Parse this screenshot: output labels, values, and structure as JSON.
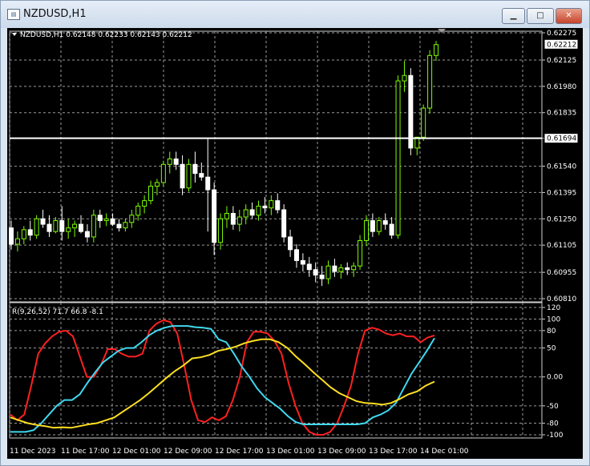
{
  "window": {
    "title": "NZDUSD,H1",
    "minimize_icon": "minimize-icon",
    "maximize_icon": "maximize-icon",
    "close_icon": "close-icon"
  },
  "colors": {
    "background": "#000000",
    "grid": "#9a9a9a",
    "bull_candle": "#7CFC00",
    "bear_candle": "#FFFFFF",
    "horizontal_line": "#FFFFFF",
    "red_line": "#FF2020",
    "cyan_line": "#40D8F0",
    "yellow_line": "#FFE020"
  },
  "chart_data": [
    {
      "type": "candlestick",
      "header": "NZDUSD,H1  0.62148 0.62233 0.62143 0.62212",
      "symbol_icon": "triangle-down-icon",
      "ylim": [
        0.6081,
        0.62275
      ],
      "yticks": [
        "0.62275",
        "0.62125",
        "0.61980",
        "0.61835",
        "0.61694",
        "0.61540",
        "0.61395",
        "0.61250",
        "0.61105",
        "0.60955",
        "0.60810"
      ],
      "price_labels": [
        {
          "value": 0.62212,
          "label": "0.62212"
        },
        {
          "value": 0.61694,
          "label": "0.61694"
        }
      ],
      "horizontal_line": 0.61694,
      "candles": [
        [
          0.612,
          0.6124,
          0.6108,
          0.6111
        ],
        [
          0.6111,
          0.6118,
          0.6107,
          0.6114
        ],
        [
          0.6114,
          0.6121,
          0.6111,
          0.6119
        ],
        [
          0.6119,
          0.6124,
          0.6113,
          0.6116
        ],
        [
          0.6116,
          0.6127,
          0.6114,
          0.6125
        ],
        [
          0.6125,
          0.613,
          0.612,
          0.6122
        ],
        [
          0.6122,
          0.6127,
          0.6115,
          0.6118
        ],
        [
          0.6118,
          0.6126,
          0.6117,
          0.6124
        ],
        [
          0.6124,
          0.6132,
          0.6113,
          0.6118
        ],
        [
          0.6118,
          0.6125,
          0.6114,
          0.612
        ],
        [
          0.612,
          0.6124,
          0.6115,
          0.6122
        ],
        [
          0.6122,
          0.6127,
          0.6117,
          0.6118
        ],
        [
          0.6118,
          0.6122,
          0.6112,
          0.6115
        ],
        [
          0.6115,
          0.613,
          0.6112,
          0.6127
        ],
        [
          0.6127,
          0.613,
          0.612,
          0.6124
        ],
        [
          0.6124,
          0.6128,
          0.6121,
          0.6125
        ],
        [
          0.6125,
          0.6128,
          0.6121,
          0.6122
        ],
        [
          0.6122,
          0.6125,
          0.6118,
          0.612
        ],
        [
          0.612,
          0.6125,
          0.6118,
          0.6123
        ],
        [
          0.6123,
          0.613,
          0.612,
          0.6127
        ],
        [
          0.6127,
          0.6134,
          0.6124,
          0.6132
        ],
        [
          0.6132,
          0.6138,
          0.6128,
          0.6135
        ],
        [
          0.6135,
          0.6146,
          0.6133,
          0.6143
        ],
        [
          0.6143,
          0.6147,
          0.6138,
          0.6145
        ],
        [
          0.6145,
          0.6157,
          0.6143,
          0.6155
        ],
        [
          0.6155,
          0.6162,
          0.615,
          0.6158
        ],
        [
          0.6158,
          0.6162,
          0.6152,
          0.6155
        ],
        [
          0.6155,
          0.616,
          0.6138,
          0.6142
        ],
        [
          0.6142,
          0.6158,
          0.614,
          0.6155
        ],
        [
          0.6155,
          0.6162,
          0.6145,
          0.615
        ],
        [
          0.615,
          0.6156,
          0.6146,
          0.6148
        ],
        [
          0.6148,
          0.6169,
          0.6118,
          0.6141
        ],
        [
          0.6141,
          0.6145,
          0.6105,
          0.6112
        ],
        [
          0.6112,
          0.6128,
          0.6108,
          0.6125
        ],
        [
          0.6125,
          0.6132,
          0.612,
          0.6128
        ],
        [
          0.6128,
          0.6132,
          0.6119,
          0.6122
        ],
        [
          0.6122,
          0.613,
          0.6118,
          0.6126
        ],
        [
          0.6126,
          0.6133,
          0.6122,
          0.613
        ],
        [
          0.613,
          0.6134,
          0.6125,
          0.6127
        ],
        [
          0.6127,
          0.6135,
          0.6124,
          0.6132
        ],
        [
          0.6132,
          0.6137,
          0.6128,
          0.6131
        ],
        [
          0.6131,
          0.6138,
          0.6127,
          0.6135
        ],
        [
          0.6135,
          0.6139,
          0.6128,
          0.613
        ],
        [
          0.613,
          0.6133,
          0.6112,
          0.6115
        ],
        [
          0.6115,
          0.6119,
          0.6104,
          0.6108
        ],
        [
          0.6108,
          0.6111,
          0.6098,
          0.6102
        ],
        [
          0.6102,
          0.6106,
          0.6096,
          0.61
        ],
        [
          0.61,
          0.6104,
          0.6093,
          0.6097
        ],
        [
          0.6097,
          0.6101,
          0.609,
          0.6094
        ],
        [
          0.6094,
          0.6099,
          0.6088,
          0.6092
        ],
        [
          0.6092,
          0.6102,
          0.6089,
          0.6099
        ],
        [
          0.6099,
          0.6103,
          0.6093,
          0.6096
        ],
        [
          0.6096,
          0.61,
          0.6092,
          0.6098
        ],
        [
          0.6098,
          0.6101,
          0.6094,
          0.6097
        ],
        [
          0.6097,
          0.6101,
          0.6093,
          0.6099
        ],
        [
          0.6099,
          0.6116,
          0.6097,
          0.6113
        ],
        [
          0.6113,
          0.6127,
          0.611,
          0.6124
        ],
        [
          0.6124,
          0.6128,
          0.6115,
          0.6118
        ],
        [
          0.6118,
          0.6126,
          0.6116,
          0.6124
        ],
        [
          0.6124,
          0.6128,
          0.6119,
          0.6122
        ],
        [
          0.6122,
          0.6126,
          0.6114,
          0.6116
        ],
        [
          0.6116,
          0.6204,
          0.6114,
          0.6201
        ],
        [
          0.6201,
          0.6212,
          0.6195,
          0.6204
        ],
        [
          0.6204,
          0.6208,
          0.616,
          0.6164
        ],
        [
          0.6164,
          0.617,
          0.616,
          0.617
        ],
        [
          0.617,
          0.6188,
          0.6168,
          0.6186
        ],
        [
          0.6186,
          0.6218,
          0.6183,
          0.6215
        ],
        [
          0.6215,
          0.6223,
          0.6212,
          0.6221
        ]
      ]
    },
    {
      "type": "line",
      "header": "R(9,26,52) 71.7 66.8 -8.1",
      "ylim": [
        -100,
        120
      ],
      "yticks": [
        "120",
        "100",
        "80",
        "50",
        "0.00",
        "-50",
        "-80",
        "-100"
      ],
      "x": [
        "11 Dec 2023",
        "11 Dec 17:00",
        "12 Dec 01:00",
        "12 Dec 09:00",
        "12 Dec 17:00",
        "13 Dec 01:00",
        "13 Dec 09:00",
        "13 Dec 17:00",
        "14 Dec 01:00"
      ],
      "series": [
        {
          "color": "#FF2020",
          "values": [
            -65,
            -75,
            -65,
            -15,
            40,
            58,
            70,
            78,
            80,
            70,
            35,
            0,
            0,
            20,
            48,
            48,
            40,
            35,
            35,
            40,
            80,
            92,
            98,
            95,
            75,
            20,
            -40,
            -75,
            -78,
            -70,
            -75,
            -68,
            -40,
            0,
            60,
            78,
            78,
            75,
            62,
            40,
            -10,
            -50,
            -80,
            -95,
            -100,
            -100,
            -95,
            -80,
            -50,
            -15,
            40,
            80,
            85,
            82,
            75,
            72,
            75,
            70,
            70,
            60,
            68,
            71.7
          ]
        },
        {
          "color": "#40D8F0",
          "values": [
            -95,
            -95,
            -95,
            -92,
            -80,
            -65,
            -50,
            -40,
            -40,
            -30,
            -10,
            8,
            25,
            35,
            45,
            50,
            50,
            60,
            72,
            80,
            85,
            88,
            88,
            88,
            86,
            85,
            83,
            65,
            60,
            40,
            18,
            0,
            -20,
            -35,
            -45,
            -55,
            -68,
            -78,
            -82,
            -82,
            -82,
            -82,
            -82,
            -82,
            -82,
            -82,
            -80,
            -70,
            -65,
            -58,
            -45,
            -20,
            5,
            25,
            45,
            66.8
          ]
        },
        {
          "color": "#FFE020",
          "values": [
            -70,
            -75,
            -80,
            -83,
            -85,
            -88,
            -87,
            -88,
            -85,
            -82,
            -80,
            -75,
            -70,
            -60,
            -50,
            -40,
            -28,
            -15,
            -2,
            10,
            20,
            32,
            34,
            38,
            45,
            48,
            52,
            58,
            62,
            65,
            65,
            60,
            50,
            35,
            22,
            8,
            -5,
            -18,
            -28,
            -35,
            -42,
            -45,
            -46,
            -48,
            -45,
            -38,
            -30,
            -25,
            -15,
            -8.1
          ]
        }
      ]
    }
  ]
}
